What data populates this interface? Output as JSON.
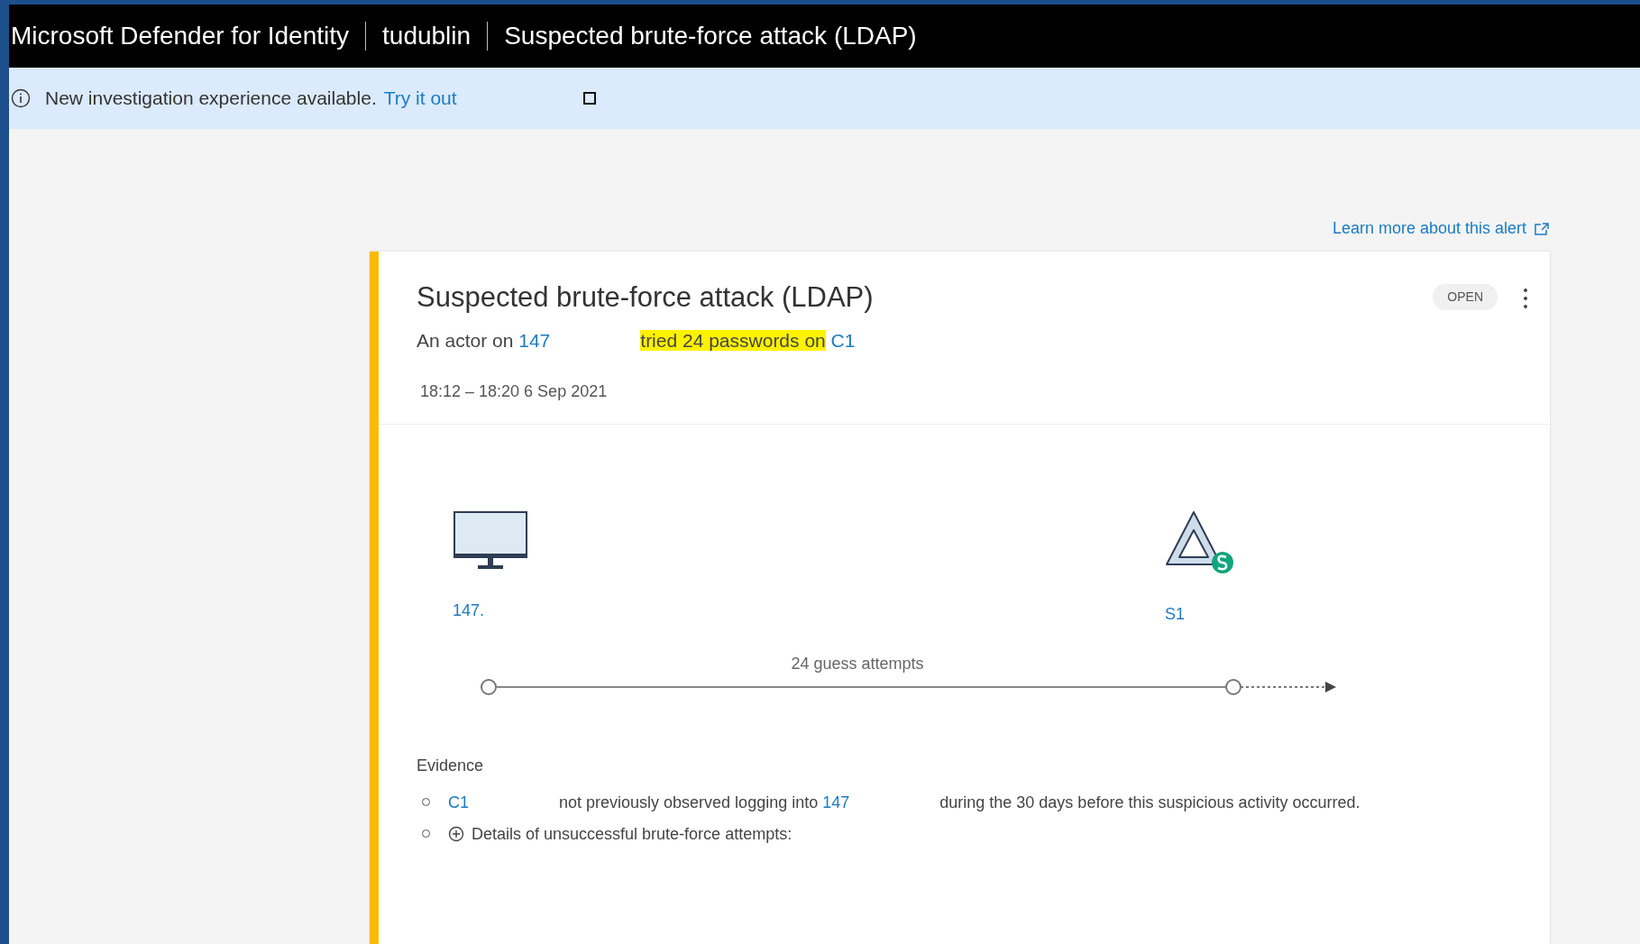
{
  "header": {
    "breadcrumbs": [
      "Microsoft Defender for Identity",
      "tudublin",
      "Suspected brute-force attack (LDAP)"
    ]
  },
  "banner": {
    "message": "New investigation experience available.",
    "link": "Try it out"
  },
  "learn_more": "Learn more about this alert",
  "alert": {
    "title": "Suspected brute-force attack (LDAP)",
    "status": "OPEN",
    "summary": [
      {
        "kind": "text",
        "text": "An actor on"
      },
      {
        "kind": "link",
        "text": "147"
      },
      {
        "kind": "highlight",
        "text": "tried 24 passwords on"
      },
      {
        "kind": "link",
        "text": "C1"
      }
    ],
    "time": "18:12 – 18:20 6 Sep 2021"
  },
  "diagram": {
    "nodes": [
      {
        "kind": "computer",
        "label": "147."
      },
      {
        "kind": "server",
        "label": "S1"
      }
    ],
    "edge_label": "24 guess attempts"
  },
  "evidence": {
    "title": "Evidence",
    "items": [
      {
        "kind": "text",
        "segments": [
          {
            "kind": "link",
            "text": "C1"
          },
          {
            "kind": "text",
            "text": "not previously observed logging into"
          },
          {
            "kind": "link",
            "text": "147"
          },
          {
            "kind": "text",
            "text": "during the 30 days before this suspicious activity occurred."
          }
        ]
      },
      {
        "kind": "expand",
        "segments": [
          {
            "kind": "text",
            "text": "Details of unsuccessful brute-force attempts:"
          }
        ]
      }
    ]
  }
}
